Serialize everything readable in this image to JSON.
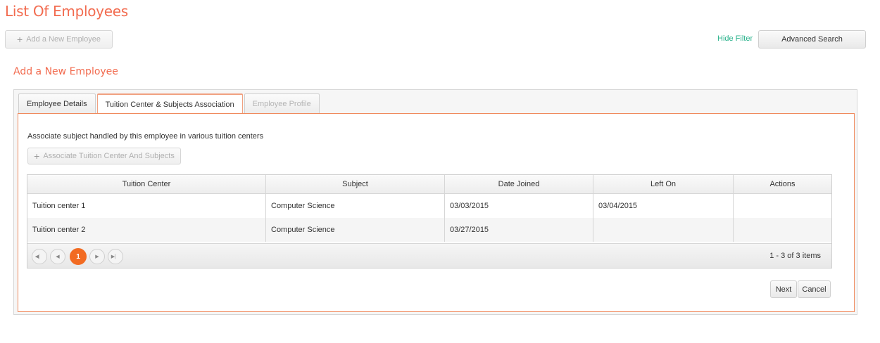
{
  "page": {
    "title": "List Of Employees"
  },
  "toolbar": {
    "add_employee_label": "Add a New Employee",
    "hide_filter_label": "Hide Filter",
    "advanced_search_label": "Advanced Search"
  },
  "section": {
    "title": "Add a New Employee"
  },
  "tabs": [
    {
      "label": "Employee Details",
      "state": "normal"
    },
    {
      "label": "Tuition Center & Subjects Association",
      "state": "active"
    },
    {
      "label": "Employee Profile",
      "state": "disabled"
    }
  ],
  "content": {
    "description": "Associate subject handled by this employee in various tuition centers",
    "associate_button_label": "Associate Tuition Center And Subjects"
  },
  "grid": {
    "columns": [
      "Tuition Center",
      "Subject",
      "Date Joined",
      "Left On",
      "Actions"
    ],
    "rows": [
      [
        "Tuition center 1",
        "Computer Science",
        "03/03/2015",
        "03/04/2015",
        ""
      ],
      [
        "Tuition center 2",
        "Computer Science",
        "03/27/2015",
        "",
        ""
      ]
    ],
    "pager": {
      "current_page": "1",
      "info": "1 - 3 of 3 items"
    }
  },
  "actions": {
    "next_label": "Next",
    "cancel_label": "Cancel"
  },
  "icons": {
    "plus": "plus-icon",
    "first": "first-page-icon",
    "prev": "prev-page-icon",
    "next": "next-page-icon",
    "last": "last-page-icon"
  },
  "colors": {
    "accent": "#f26b4f",
    "filter_link": "#2bb38c",
    "pager_active": "#f26b22",
    "tab_border": "#f08a5d"
  }
}
